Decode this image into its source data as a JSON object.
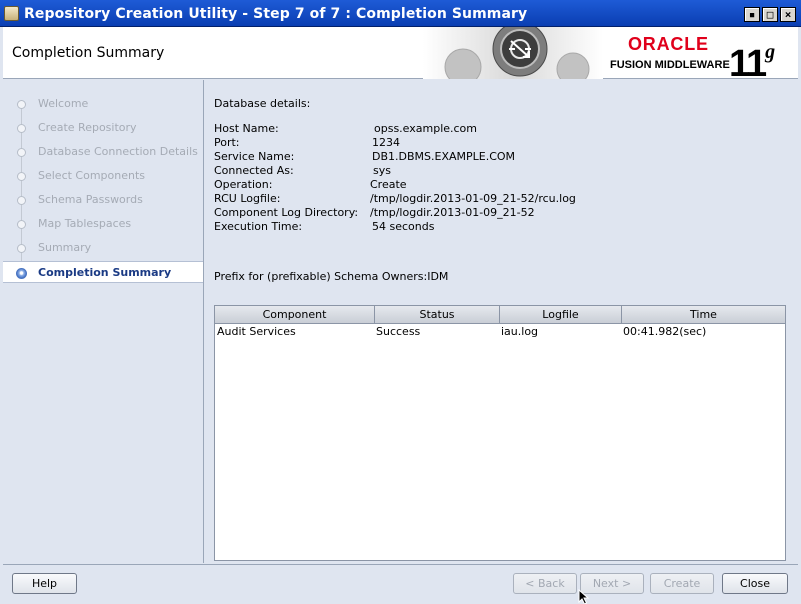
{
  "window": {
    "title": "Repository Creation Utility - Step 7 of 7 : Completion Summary",
    "minimize_glyph": "▪",
    "maximize_glyph": "□",
    "close_glyph": "×"
  },
  "header": {
    "page_title": "Completion Summary",
    "brand": "ORACLE",
    "brand_sub": "FUSION MIDDLEWARE",
    "version_main": "11",
    "version_sup": "g",
    "brand_color": "#e0001b"
  },
  "nav": {
    "items": [
      {
        "label": "Welcome",
        "state": "done"
      },
      {
        "label": "Create Repository",
        "state": "done"
      },
      {
        "label": "Database Connection Details",
        "state": "done"
      },
      {
        "label": "Select Components",
        "state": "done"
      },
      {
        "label": "Schema Passwords",
        "state": "done"
      },
      {
        "label": "Map Tablespaces",
        "state": "done"
      },
      {
        "label": "Summary",
        "state": "done"
      },
      {
        "label": "Completion Summary",
        "state": "current"
      }
    ]
  },
  "details": {
    "heading": "Database details:",
    "rows": [
      {
        "key": "Host Name:",
        "value": "opss.example.com"
      },
      {
        "key": "Port:",
        "value": "1234"
      },
      {
        "key": "Service Name:",
        "value": "DB1.DBMS.EXAMPLE.COM"
      },
      {
        "key": "Connected As:",
        "value": "sys"
      },
      {
        "key": "Operation:",
        "value": "Create"
      },
      {
        "key": "RCU Logfile:",
        "value": "/tmp/logdir.2013-01-09_21-52/rcu.log"
      },
      {
        "key": "Component Log Directory:",
        "value": "/tmp/logdir.2013-01-09_21-52"
      },
      {
        "key": "Execution Time:",
        "value": "54  seconds"
      }
    ],
    "prefix": "Prefix for (prefixable) Schema Owners:IDM"
  },
  "table": {
    "columns": [
      "Component",
      "Status",
      "Logfile",
      "Time"
    ],
    "rows": [
      [
        "Audit Services",
        "Success",
        "iau.log",
        "00:41.982(sec)"
      ]
    ]
  },
  "footer": {
    "help": "Help",
    "back": "< Back",
    "next": "Next >",
    "create": "Create",
    "close": "Close"
  }
}
